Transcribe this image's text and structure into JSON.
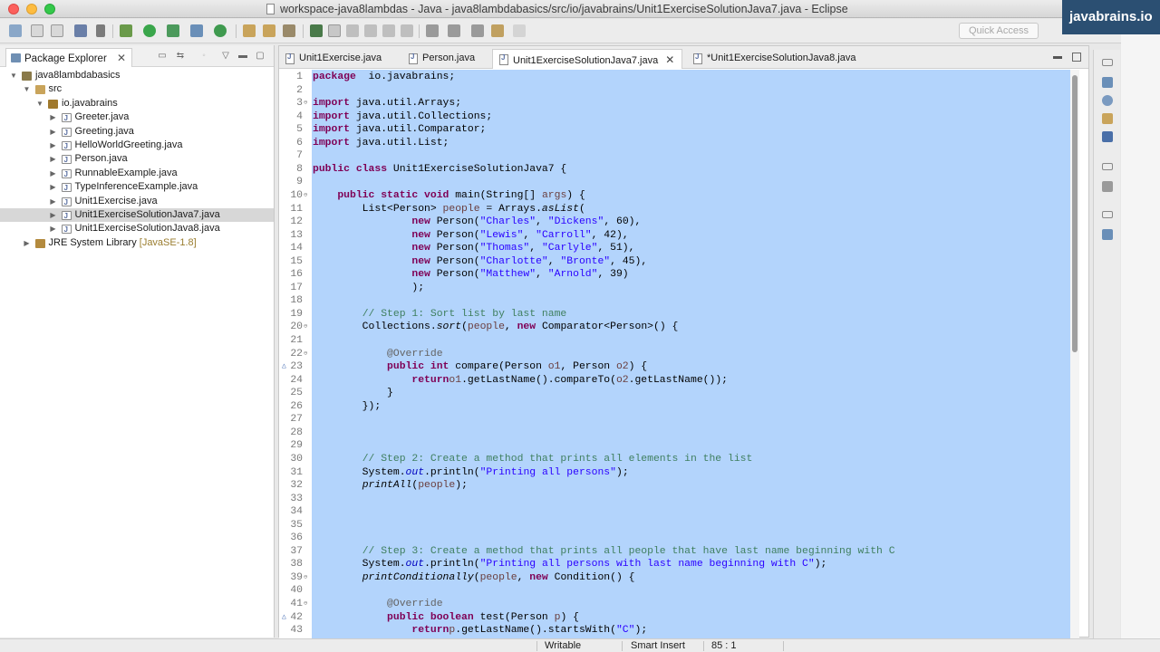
{
  "window": {
    "title": "workspace-java8lambdas - Java - java8lambdabasics/src/io/javabrains/Unit1ExerciseSolutionJava7.java - Eclipse",
    "watermark": "javabrains.io"
  },
  "toolbar": {
    "quick_access_placeholder": "Quick Access"
  },
  "explorer": {
    "tab_label": "Package Explorer",
    "tree": [
      {
        "label": "java8lambdabasics",
        "icon": "project-icon",
        "depth": 0,
        "expanded": true
      },
      {
        "label": "src",
        "icon": "source-folder-icon",
        "depth": 1,
        "expanded": true
      },
      {
        "label": "io.javabrains",
        "icon": "package-icon",
        "depth": 2,
        "expanded": true
      },
      {
        "label": "Greeter.java",
        "icon": "java-file-icon",
        "depth": 3,
        "expanded": false
      },
      {
        "label": "Greeting.java",
        "icon": "java-file-icon",
        "depth": 3,
        "expanded": false
      },
      {
        "label": "HelloWorldGreeting.java",
        "icon": "java-file-icon",
        "depth": 3,
        "expanded": false
      },
      {
        "label": "Person.java",
        "icon": "java-file-icon",
        "depth": 3,
        "expanded": false
      },
      {
        "label": "RunnableExample.java",
        "icon": "java-file-icon",
        "depth": 3,
        "expanded": false
      },
      {
        "label": "TypeInferenceExample.java",
        "icon": "java-file-icon",
        "depth": 3,
        "expanded": false
      },
      {
        "label": "Unit1Exercise.java",
        "icon": "java-file-icon",
        "depth": 3,
        "expanded": false
      },
      {
        "label": "Unit1ExerciseSolutionJava7.java",
        "icon": "java-file-icon",
        "depth": 3,
        "expanded": false,
        "selected": true
      },
      {
        "label": "Unit1ExerciseSolutionJava8.java",
        "icon": "java-file-icon",
        "depth": 3,
        "expanded": false
      },
      {
        "label": "JRE System Library",
        "decoration": "[JavaSE-1.8]",
        "icon": "library-icon",
        "depth": 1,
        "expanded": false
      }
    ]
  },
  "editor": {
    "tabs": [
      {
        "label": "Unit1Exercise.java",
        "active": false
      },
      {
        "label": "Person.java",
        "active": false
      },
      {
        "label": "Unit1ExerciseSolutionJava7.java",
        "active": true
      },
      {
        "label": "*Unit1ExerciseSolutionJava8.java",
        "active": false
      }
    ],
    "lines": [
      {
        "n": "1",
        "tokens": [
          [
            "kw",
            "package"
          ],
          [
            "",
            "  io.javabrains;"
          ]
        ]
      },
      {
        "n": "2",
        "tokens": []
      },
      {
        "n": "3",
        "fold": "⊖",
        "tokens": [
          [
            "kw",
            "import"
          ],
          [
            "",
            " java.util.Arrays;"
          ]
        ]
      },
      {
        "n": "4",
        "tokens": [
          [
            "kw",
            "import"
          ],
          [
            "",
            " java.util.Collections;"
          ]
        ]
      },
      {
        "n": "5",
        "tokens": [
          [
            "kw",
            "import"
          ],
          [
            "",
            " java.util.Comparator;"
          ]
        ]
      },
      {
        "n": "6",
        "tokens": [
          [
            "kw",
            "import"
          ],
          [
            "",
            " java.util.List;"
          ]
        ]
      },
      {
        "n": "7",
        "tokens": []
      },
      {
        "n": "8",
        "tokens": [
          [
            "kw",
            "public class"
          ],
          [
            "",
            " Unit1ExerciseSolutionJava7 {"
          ]
        ]
      },
      {
        "n": "9",
        "tokens": []
      },
      {
        "n": "10",
        "fold": "⊖",
        "tokens": [
          [
            "",
            "    "
          ],
          [
            "kw",
            "public static void"
          ],
          [
            "",
            " main(String[] "
          ],
          [
            "var",
            "args"
          ],
          [
            "",
            ") {"
          ]
        ]
      },
      {
        "n": "11",
        "tokens": [
          [
            "",
            "        List<Person> "
          ],
          [
            "var",
            "people"
          ],
          [
            "",
            " = Arrays."
          ],
          [
            "it",
            "asList"
          ],
          [
            "",
            "("
          ]
        ]
      },
      {
        "n": "12",
        "tokens": [
          [
            "",
            "                "
          ],
          [
            "kw",
            "new"
          ],
          [
            "",
            " Person("
          ],
          [
            "str",
            "\"Charles\""
          ],
          [
            "",
            ", "
          ],
          [
            "str",
            "\"Dickens\""
          ],
          [
            "",
            ", 60),"
          ]
        ]
      },
      {
        "n": "13",
        "tokens": [
          [
            "",
            "                "
          ],
          [
            "kw",
            "new"
          ],
          [
            "",
            " Person("
          ],
          [
            "str",
            "\"Lewis\""
          ],
          [
            "",
            ", "
          ],
          [
            "str",
            "\"Carroll\""
          ],
          [
            "",
            ", 42),"
          ]
        ]
      },
      {
        "n": "14",
        "tokens": [
          [
            "",
            "                "
          ],
          [
            "kw",
            "new"
          ],
          [
            "",
            " Person("
          ],
          [
            "str",
            "\"Thomas\""
          ],
          [
            "",
            ", "
          ],
          [
            "str",
            "\"Carlyle\""
          ],
          [
            "",
            ", 51),"
          ]
        ]
      },
      {
        "n": "15",
        "tokens": [
          [
            "",
            "                "
          ],
          [
            "kw",
            "new"
          ],
          [
            "",
            " Person("
          ],
          [
            "str",
            "\"Charlotte\""
          ],
          [
            "",
            ", "
          ],
          [
            "str",
            "\"Bronte\""
          ],
          [
            "",
            ", 45),"
          ]
        ]
      },
      {
        "n": "16",
        "tokens": [
          [
            "",
            "                "
          ],
          [
            "kw",
            "new"
          ],
          [
            "",
            " Person("
          ],
          [
            "str",
            "\"Matthew\""
          ],
          [
            "",
            ", "
          ],
          [
            "str",
            "\"Arnold\""
          ],
          [
            "",
            ", 39)"
          ]
        ]
      },
      {
        "n": "17",
        "tokens": [
          [
            "",
            "                );"
          ]
        ]
      },
      {
        "n": "18",
        "tokens": []
      },
      {
        "n": "19",
        "tokens": [
          [
            "",
            "        "
          ],
          [
            "cmt",
            "// Step 1: Sort list by last name"
          ]
        ]
      },
      {
        "n": "20",
        "fold": "⊖",
        "tokens": [
          [
            "",
            "        Collections."
          ],
          [
            "it",
            "sort"
          ],
          [
            "",
            "("
          ],
          [
            "var",
            "people"
          ],
          [
            "",
            ", "
          ],
          [
            "kw",
            "new"
          ],
          [
            "",
            " Comparator<Person>() {"
          ]
        ]
      },
      {
        "n": "21",
        "tokens": []
      },
      {
        "n": "22",
        "fold": "⊖",
        "tokens": [
          [
            "",
            "            "
          ],
          [
            "ann",
            "@Override"
          ]
        ]
      },
      {
        "n": "23",
        "marker": "△",
        "tokens": [
          [
            "",
            "            "
          ],
          [
            "kw",
            "public int"
          ],
          [
            "",
            " compare(Person "
          ],
          [
            "var",
            "o1"
          ],
          [
            "",
            ", Person "
          ],
          [
            "var",
            "o2"
          ],
          [
            "",
            ") {"
          ]
        ]
      },
      {
        "n": "24",
        "tokens": [
          [
            "",
            "                "
          ],
          [
            "kw",
            "return"
          ],
          [
            " ",
            ""
          ],
          [
            "var",
            "o1"
          ],
          [
            "",
            ".getLastName().compareTo("
          ],
          [
            "var",
            "o2"
          ],
          [
            "",
            ".getLastName());"
          ]
        ]
      },
      {
        "n": "25",
        "tokens": [
          [
            "",
            "            }"
          ]
        ]
      },
      {
        "n": "26",
        "tokens": [
          [
            "",
            "        });"
          ]
        ]
      },
      {
        "n": "27",
        "tokens": []
      },
      {
        "n": "28",
        "tokens": []
      },
      {
        "n": "29",
        "tokens": []
      },
      {
        "n": "30",
        "tokens": [
          [
            "",
            "        "
          ],
          [
            "cmt",
            "// Step 2: Create a method that prints all elements in the list"
          ]
        ]
      },
      {
        "n": "31",
        "tokens": [
          [
            "",
            "        System."
          ],
          [
            "fld",
            "out"
          ],
          [
            "",
            ".println("
          ],
          [
            "str",
            "\"Printing all persons\""
          ],
          [
            "",
            ");"
          ]
        ]
      },
      {
        "n": "32",
        "tokens": [
          [
            "",
            "        "
          ],
          [
            "it",
            "printAll"
          ],
          [
            "",
            "("
          ],
          [
            "var",
            "people"
          ],
          [
            "",
            ");"
          ]
        ]
      },
      {
        "n": "33",
        "tokens": []
      },
      {
        "n": "34",
        "tokens": []
      },
      {
        "n": "35",
        "tokens": []
      },
      {
        "n": "36",
        "tokens": []
      },
      {
        "n": "37",
        "tokens": [
          [
            "",
            "        "
          ],
          [
            "cmt",
            "// Step 3: Create a method that prints all people that have last name beginning with C"
          ]
        ]
      },
      {
        "n": "38",
        "tokens": [
          [
            "",
            "        System."
          ],
          [
            "fld",
            "out"
          ],
          [
            "",
            ".println("
          ],
          [
            "str",
            "\"Printing all persons with last name beginning with C\""
          ],
          [
            "",
            ");"
          ]
        ]
      },
      {
        "n": "39",
        "fold": "⊖",
        "tokens": [
          [
            "",
            "        "
          ],
          [
            "it",
            "printConditionally"
          ],
          [
            "",
            "("
          ],
          [
            "var",
            "people"
          ],
          [
            "",
            ", "
          ],
          [
            "kw",
            "new"
          ],
          [
            "",
            " Condition() {"
          ]
        ]
      },
      {
        "n": "40",
        "tokens": []
      },
      {
        "n": "41",
        "fold": "⊖",
        "tokens": [
          [
            "",
            "            "
          ],
          [
            "ann",
            "@Override"
          ]
        ]
      },
      {
        "n": "42",
        "marker": "△",
        "tokens": [
          [
            "",
            "            "
          ],
          [
            "kw",
            "public boolean"
          ],
          [
            "",
            " test(Person "
          ],
          [
            "var",
            "p"
          ],
          [
            "",
            ") {"
          ]
        ]
      },
      {
        "n": "43",
        "tokens": [
          [
            "",
            "                "
          ],
          [
            "kw",
            "return"
          ],
          [
            " ",
            ""
          ],
          [
            "var",
            "p"
          ],
          [
            "",
            ".getLastName().startsWith("
          ],
          [
            "str",
            "\"C\""
          ],
          [
            "",
            ");"
          ]
        ]
      }
    ]
  },
  "statusbar": {
    "mode": "Writable",
    "insert_mode": "Smart Insert",
    "position": "85 : 1"
  },
  "colors": {
    "selection": "#b3d4fc",
    "keyword": "#7f0055",
    "string": "#2a00ff",
    "comment": "#3f7f5f"
  }
}
